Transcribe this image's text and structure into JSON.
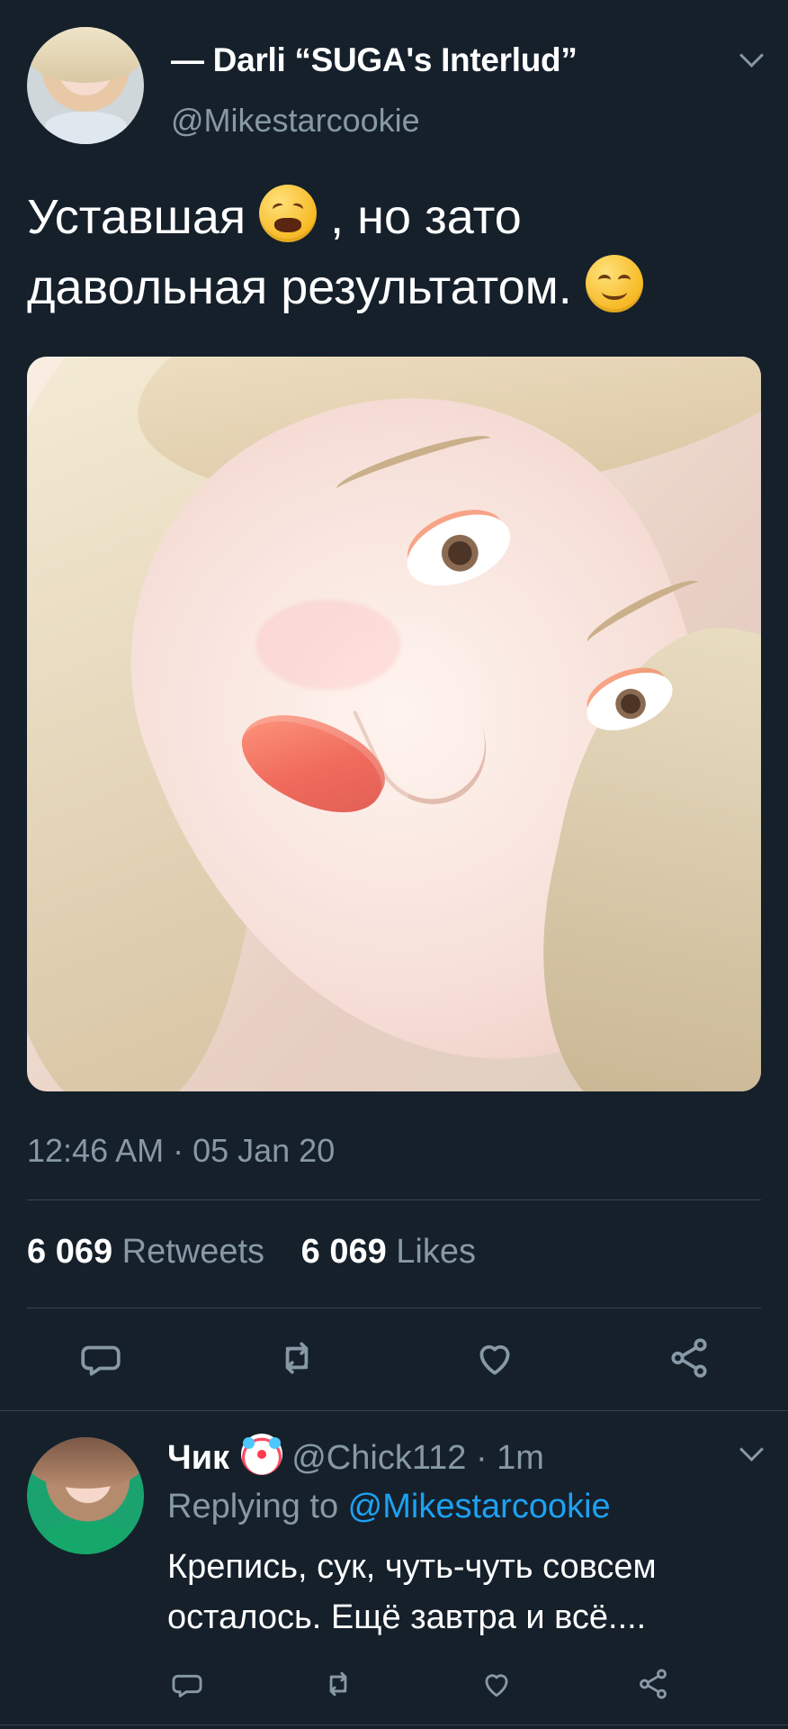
{
  "tweet": {
    "author_name": "— Darli “SUGA's Interlud”",
    "handle": "@Mikestarcookie",
    "text_line1_start": "Уставшая",
    "text_line1_end": ", но зато",
    "text_line2": "давольная результатом.",
    "timestamp": "12:46 AM · 05 Jan 20",
    "retweets_count": "6 069",
    "retweets_label": "Retweets",
    "likes_count": "6 069",
    "likes_label": "Likes"
  },
  "reply": {
    "author_name": "Чик",
    "handle_time": "@Chick112 · 1m",
    "replying_prefix": "Replying to ",
    "replying_to": "@Mikestarcookie",
    "text": "Крепись, сук, чуть-чуть совсем осталось. Ещё завтра и всё...."
  },
  "icons": {
    "reply": "reply-icon",
    "retweet": "retweet-icon",
    "like": "like-icon",
    "share": "share-icon",
    "more": "chevron-down-icon"
  },
  "colors": {
    "background": "#15202b",
    "primary_text": "#ffffff",
    "secondary_text": "#8899a6",
    "divider": "#38444d",
    "link": "#1da1f2"
  }
}
